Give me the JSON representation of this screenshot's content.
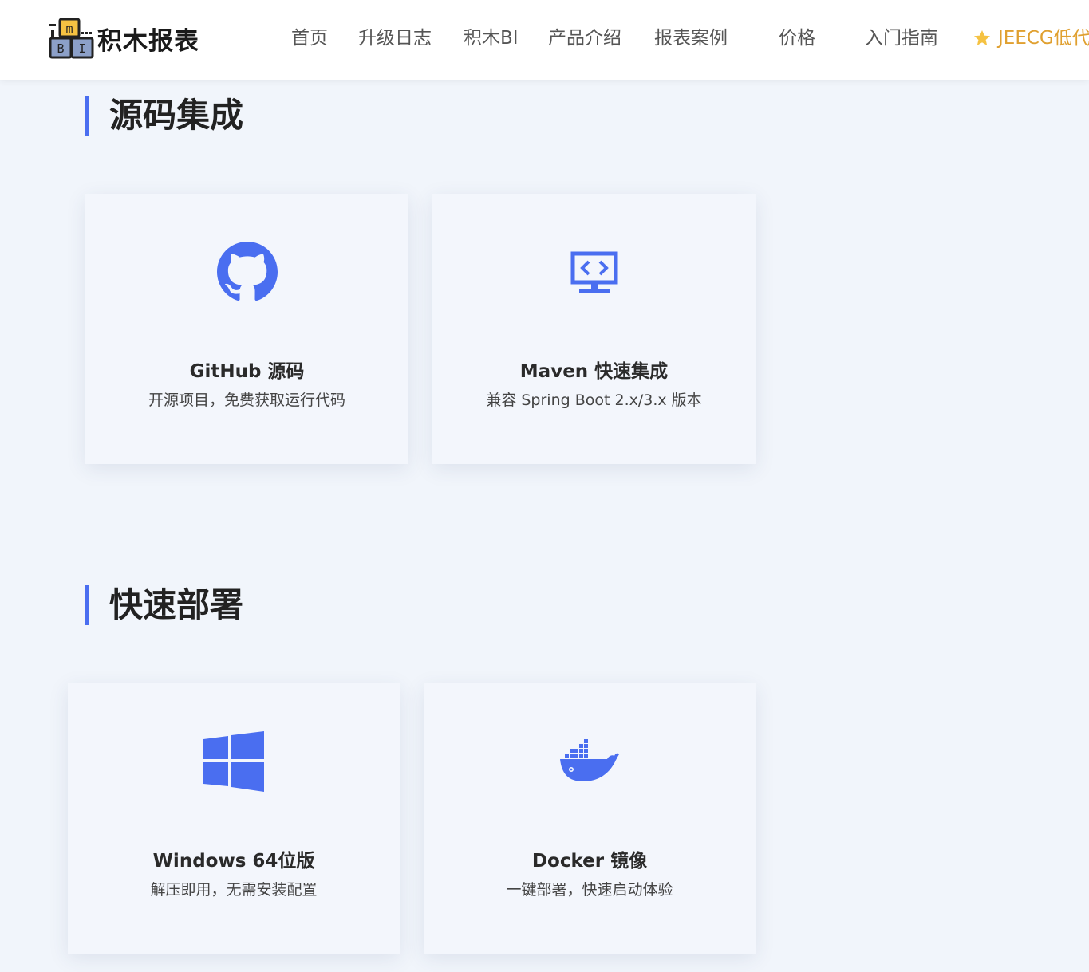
{
  "header": {
    "logo_text": "积木报表",
    "logo_block_top": "m",
    "logo_block_left": "B",
    "logo_block_right": "I",
    "nav": [
      {
        "label": "首页"
      },
      {
        "label": "升级日志"
      },
      {
        "label": "积木BI"
      },
      {
        "label": "产品介绍"
      },
      {
        "label": "报表案例"
      },
      {
        "label": "价格"
      },
      {
        "label": "入门指南"
      }
    ],
    "promo_label": "JEECG低代码",
    "promo_icon": "star-icon"
  },
  "colors": {
    "accent": "#4a6ef0",
    "background": "#f1f5fb",
    "promo": "#e0a030"
  },
  "sections": [
    {
      "title": "源码集成",
      "cards": [
        {
          "icon": "github-icon",
          "title": "GitHub 源码",
          "desc": "开源项目，免费获取运行代码"
        },
        {
          "icon": "code-monitor-icon",
          "title": "Maven 快速集成",
          "desc": "兼容 Spring Boot 2.x/3.x 版本"
        }
      ]
    },
    {
      "title": "快速部署",
      "cards": [
        {
          "icon": "windows-icon",
          "title": "Windows 64位版",
          "desc": "解压即用，无需安装配置"
        },
        {
          "icon": "docker-icon",
          "title": "Docker 镜像",
          "desc": "一键部署，快速启动体验"
        }
      ]
    }
  ]
}
